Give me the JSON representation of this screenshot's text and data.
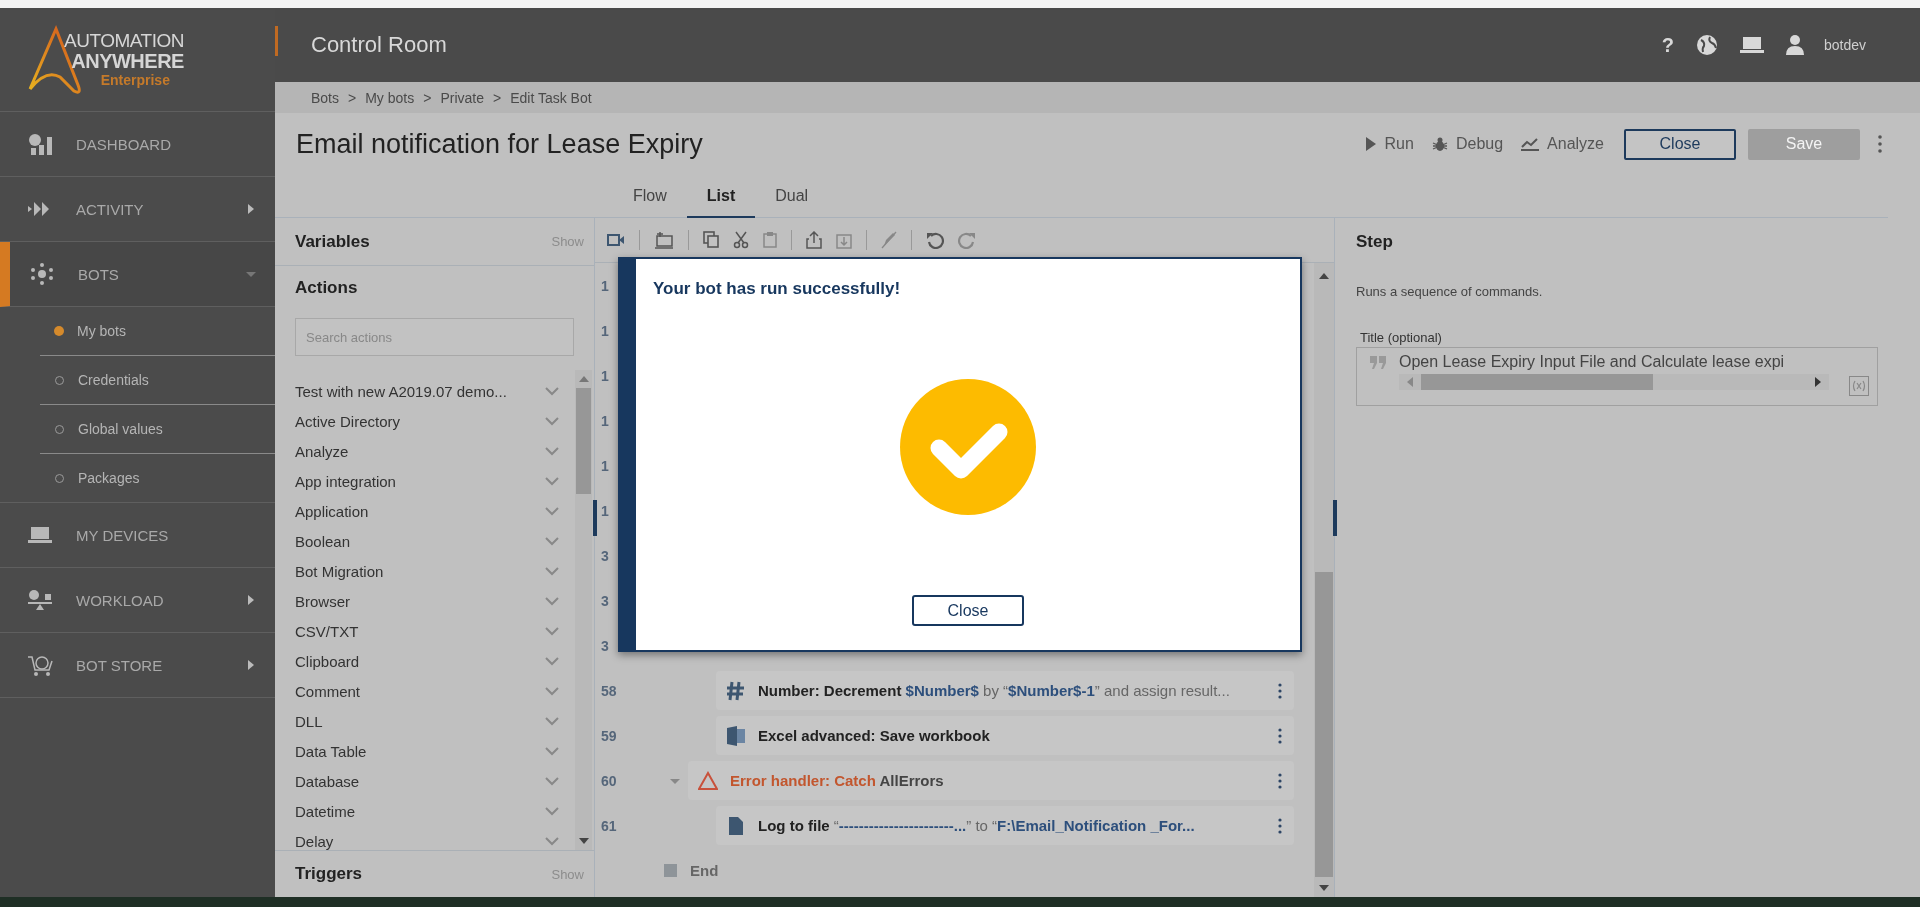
{
  "logo": {
    "line1": "AUTOMATION",
    "line2": "ANYWHERE",
    "line3": "Enterprise"
  },
  "header": {
    "title": "Control Room",
    "help": "?",
    "user": "botdev"
  },
  "sidebar": {
    "items": [
      {
        "label": "DASHBOARD",
        "kind": "dashboard",
        "selected": false
      },
      {
        "label": "ACTIVITY",
        "kind": "activity",
        "selected": false,
        "expanded": false
      },
      {
        "label": "BOTS",
        "kind": "bots",
        "selected": true,
        "expanded": true,
        "children": [
          {
            "label": "My bots",
            "selected": true
          },
          {
            "label": "Credentials",
            "selected": false
          },
          {
            "label": "Global values",
            "selected": false
          },
          {
            "label": "Packages",
            "selected": false
          }
        ]
      },
      {
        "label": "MY DEVICES",
        "kind": "devices",
        "selected": false
      },
      {
        "label": "WORKLOAD",
        "kind": "workload",
        "selected": false,
        "expanded": false
      },
      {
        "label": "BOT STORE",
        "kind": "store",
        "selected": false,
        "expanded": false
      }
    ]
  },
  "breadcrumb": {
    "separator": ">",
    "items": [
      "Bots",
      "My bots",
      "Private",
      "Edit Task Bot"
    ]
  },
  "editor": {
    "title": "Email notification for Lease Expiry",
    "actions": [
      {
        "label": "Run",
        "kind": "run"
      },
      {
        "label": "Debug",
        "kind": "debug"
      },
      {
        "label": "Analyze",
        "kind": "analyze"
      }
    ],
    "buttons": [
      {
        "label": "Close",
        "disabled": false
      },
      {
        "label": "Save",
        "disabled": true
      }
    ],
    "tabs": [
      {
        "label": "Flow",
        "selected": false
      },
      {
        "label": "List",
        "selected": true
      },
      {
        "label": "Dual",
        "selected": false
      }
    ]
  },
  "left_panel": {
    "variables": {
      "title": "Variables",
      "toggle": "Show"
    },
    "actions": {
      "title": "Actions",
      "search_placeholder": "Search actions",
      "items": [
        "Test with new A2019.07 demo...",
        "Active Directory",
        "Analyze",
        "App integration",
        "Application",
        "Boolean",
        "Bot Migration",
        "Browser",
        "CSV/TXT",
        "Clipboard",
        "Comment",
        "DLL",
        "Data Table",
        "Database",
        "Datetime",
        "Delay"
      ]
    },
    "triggers": {
      "title": "Triggers",
      "toggle": "Show"
    }
  },
  "step_list": {
    "rows": [
      {
        "number": "1"
      },
      {
        "number": "1"
      },
      {
        "number": "1"
      },
      {
        "number": "1"
      },
      {
        "number": "1"
      },
      {
        "number": "1"
      },
      {
        "number": "3"
      },
      {
        "number": "3"
      },
      {
        "number": "3",
        "children": [
          {
            "number": "58",
            "kind": "number",
            "parts": [
              {
                "kind": "cmd",
                "text": "Number: Decrement "
              },
              {
                "kind": "var",
                "text": "$Number$"
              },
              {
                "kind": "plain",
                "text": " by “"
              },
              {
                "kind": "var",
                "text": "$Number$-1"
              },
              {
                "kind": "plain",
                "text": "” and assign result..."
              }
            ]
          },
          {
            "number": "59",
            "kind": "excel",
            "parts": [
              {
                "kind": "cmd",
                "text": "Excel advanced: Save workbook"
              }
            ]
          }
        ]
      },
      {
        "number": "60",
        "kind": "error",
        "expanded": true,
        "parts": [
          {
            "kind": "error",
            "text": "Error handler: Catch "
          },
          {
            "kind": "name",
            "text": "AllErrors"
          }
        ],
        "children": [
          {
            "number": "61",
            "kind": "log",
            "parts": [
              {
                "kind": "cmd",
                "text": "Log to file "
              },
              {
                "kind": "plain",
                "text": "“"
              },
              {
                "kind": "var",
                "text": "-----------------------..."
              },
              {
                "kind": "plain",
                "text": "” to “"
              },
              {
                "kind": "var",
                "text": "F:\\Email_Notification _For..."
              }
            ]
          }
        ]
      }
    ],
    "end": "End"
  },
  "step_panel": {
    "title": "Step",
    "description": "Runs a sequence of commands.",
    "field_label": "Title (optional)",
    "field_value": "Open Lease Expiry Input File and Calculate lease expi"
  },
  "dialog": {
    "message": "Your bot has run successfully!",
    "button": "Close"
  }
}
